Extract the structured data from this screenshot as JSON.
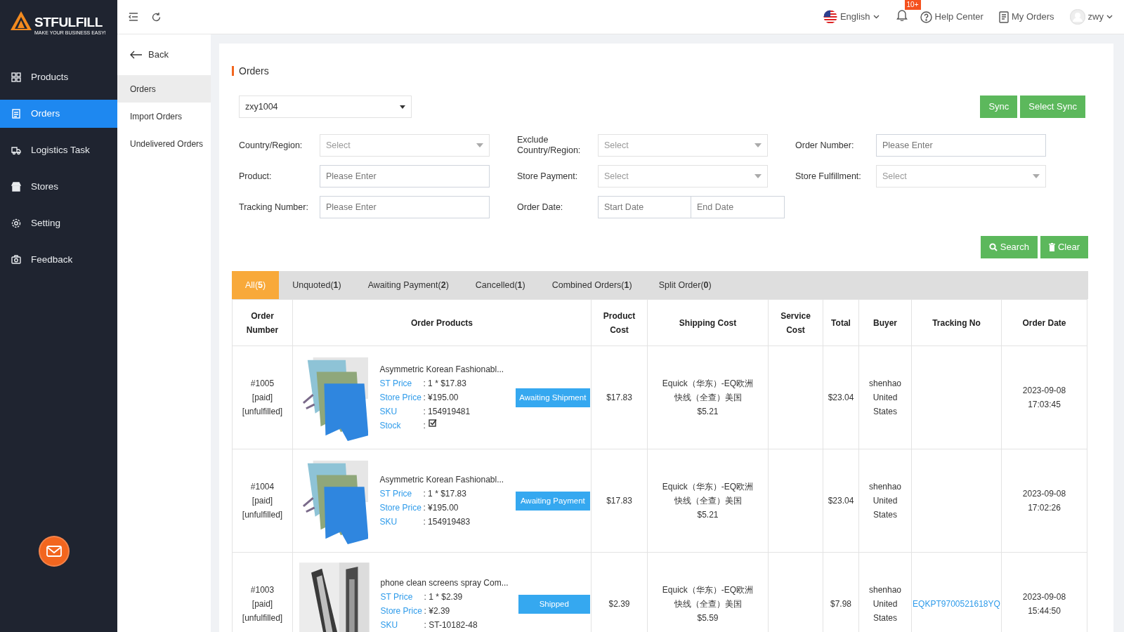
{
  "logo": {
    "name": "STFULFILL",
    "tagline": "MAKE YOUR BUSINESS EASY!"
  },
  "sidebar": {
    "items": [
      {
        "label": "Products",
        "selected": false
      },
      {
        "label": "Orders",
        "selected": true
      },
      {
        "label": "Logistics Task",
        "selected": false
      },
      {
        "label": "Stores",
        "selected": false
      },
      {
        "label": "Setting",
        "selected": false
      },
      {
        "label": "Feedback",
        "selected": false
      }
    ]
  },
  "submenu": {
    "back": "Back",
    "items": [
      {
        "label": "Orders",
        "selected": true
      },
      {
        "label": "Import Orders",
        "selected": false
      },
      {
        "label": "Undelivered Orders",
        "selected": false
      }
    ]
  },
  "header": {
    "language": "English",
    "notifications_badge": "10+",
    "help": "Help Center",
    "my_orders": "My Orders",
    "user": "zwy"
  },
  "page_title": "Orders",
  "store_select": "zxy1004",
  "sync_buttons": [
    "Sync",
    "Select Sync"
  ],
  "filters": [
    {
      "label": "Country/Region:",
      "kind": "select",
      "placeholder": "Select"
    },
    {
      "label": "Exclude Country/Region:",
      "kind": "select",
      "placeholder": "Select"
    },
    {
      "label": "Order Number:",
      "kind": "input",
      "placeholder": "Please Enter"
    },
    {
      "label": "Product:",
      "kind": "input",
      "placeholder": "Please Enter"
    },
    {
      "label": "Store Payment:",
      "kind": "select",
      "placeholder": "Select"
    },
    {
      "label": "Store Fulfillment:",
      "kind": "select",
      "placeholder": "Select"
    },
    {
      "label": "Tracking Number:",
      "kind": "input",
      "placeholder": "Please Enter"
    },
    {
      "label": "Order Date:",
      "kind": "daterange",
      "placeholder": "Start Date",
      "placeholder_end": "End Date"
    }
  ],
  "search_buttons": [
    "Search",
    "Clear"
  ],
  "tabs": [
    {
      "label": "All(**5**)",
      "selected": true
    },
    {
      "label": "Unquoted(**1**)",
      "selected": false
    },
    {
      "label": "Awaiting Payment(**2**)",
      "selected": false
    },
    {
      "label": "Cancelled(**1**)",
      "selected": false
    },
    {
      "label": "Combined Orders(**1**)",
      "selected": false
    },
    {
      "label": "Split Order(**0**)",
      "selected": false
    }
  ],
  "table": {
    "columns": [
      "Order Number",
      "Order Products",
      "Product Cost",
      "Shipping Cost",
      "Service Cost",
      "Total",
      "Buyer",
      "Tracking No",
      "Order Date"
    ],
    "rows": [
      {
        "order": [
          "#1005",
          "[paid]",
          "[unfulfilled]"
        ],
        "product": {
          "name": "Asymmetric Korean Fashionabl...",
          "details": [
            {
              "kind": "text",
              "label": "ST Price",
              "value": ": 1 * $17.83"
            },
            {
              "kind": "text",
              "label": "Store Price",
              "value": ": ¥195.00"
            },
            {
              "kind": "text",
              "label": "SKU",
              "value": ": 154919481"
            },
            {
              "kind": "check",
              "label": "Stock",
              "value": ":",
              "checked": true
            }
          ]
        },
        "status": "Awaiting Shipment",
        "product_cost": "$17.83",
        "shipping": "Equick（华东）-EQ欧洲快线（全查）美国",
        "shipping_price": "$5.21",
        "total": "$23.04",
        "buyer": "shenhao United States",
        "date": "2023-09-08 17:03:45"
      },
      {
        "order": [
          "#1004",
          "[paid]",
          "[unfulfilled]"
        ],
        "product": {
          "name": "Asymmetric Korean Fashionabl...",
          "details": [
            {
              "kind": "text",
              "label": "ST Price",
              "value": ": 1 * $17.83"
            },
            {
              "kind": "text",
              "label": "Store Price",
              "value": ": ¥195.00"
            },
            {
              "kind": "text",
              "label": "SKU",
              "value": ": 154919483"
            }
          ]
        },
        "status": "Awaiting Payment",
        "product_cost": "$17.83",
        "shipping": "Equick（华东）-EQ欧洲快线（全查）美国",
        "shipping_price": "$5.21",
        "total": "$23.04",
        "buyer": "shenhao United States",
        "date": "2023-09-08 17:02:26"
      },
      {
        "order": [
          "#1003",
          "[paid]",
          "[unfulfilled]"
        ],
        "product": {
          "name": "phone clean screens spray Com...",
          "details": [
            {
              "kind": "text",
              "label": "ST Price",
              "value": ": 1 * $2.39"
            },
            {
              "kind": "text",
              "label": "Store Price",
              "value": ": ¥2.39"
            },
            {
              "kind": "text",
              "label": "SKU",
              "value": ": ST-10182-48"
            }
          ]
        },
        "status": "Shipped",
        "product_cost": "$2.39",
        "shipping": "Equick（华东）-EQ欧洲快线（全查）美国",
        "shipping_price": "$5.59",
        "total": "$7.98",
        "buyer": "shenhao United States",
        "tracking": "EQKPT9700521618YQ",
        "date": "2023-09-08 15:44:50"
      }
    ]
  }
}
